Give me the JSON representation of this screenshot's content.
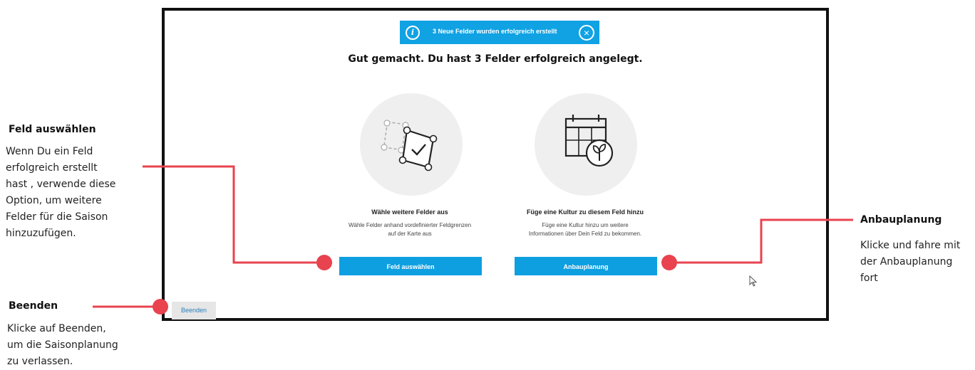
{
  "annotations": {
    "feld": {
      "title": "Feld auswählen",
      "lines": [
        "Wenn Du ein Feld",
        "erfolgreich erstellt",
        "hast , verwende diese",
        "Option, um weitere",
        "Felder für die Saison",
        "hinzuzufügen."
      ]
    },
    "beenden": {
      "title": "Beenden",
      "lines": [
        "Klicke auf Beenden,",
        "um die Saisonplanung",
        "zu verlassen."
      ]
    },
    "anbau": {
      "title": "Anbauplanung",
      "lines": [
        "Klicke und fahre mit",
        "der Anbauplanung",
        "fort"
      ]
    }
  },
  "app": {
    "toast": {
      "message": "3 Neue Felder wurden erfolgreich erstellt",
      "info_glyph": "i",
      "close_glyph": "×"
    },
    "headline": "Gut gemacht. Du hast 3 Felder erfolgreich angelegt.",
    "options": [
      {
        "icon": "field-select-icon",
        "title": "Wähle weitere Felder aus",
        "desc": [
          "Wähle Felder anhand vordefinierter Feldgrenzen",
          "auf der Karte aus"
        ],
        "button": "Feld auswählen"
      },
      {
        "icon": "calendar-plant-icon",
        "title": "Füge eine Kultur zu diesem Feld hinzu",
        "desc": [
          "Füge eine Kultur hinzu um weitere",
          "Informationen über Dein Feld zu bekommen."
        ],
        "button": "Anbauplanung"
      }
    ],
    "quit_button": "Beenden"
  },
  "colors": {
    "accent": "#0e9fe1",
    "toast": "#10a2e3",
    "callout": "#e8434f",
    "icon_bg": "#efefef"
  }
}
